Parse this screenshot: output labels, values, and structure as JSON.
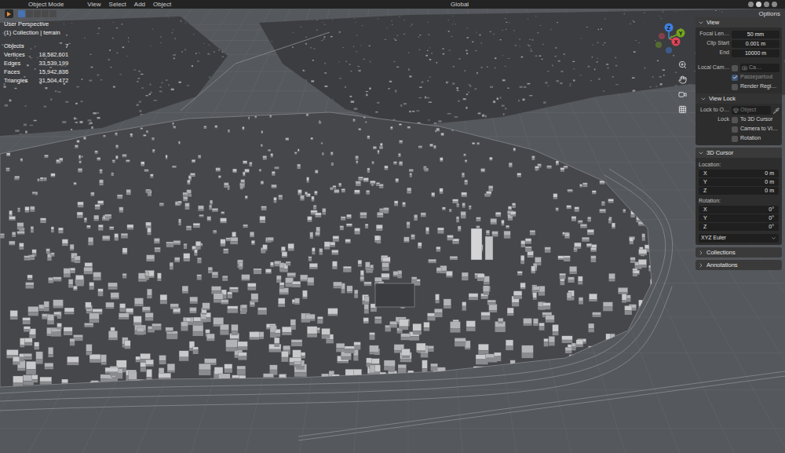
{
  "header": {
    "menus": [
      "Object Mode",
      "View",
      "Select",
      "Add",
      "Object"
    ],
    "orientation": "Global",
    "options": "Options",
    "select_modes": [
      {
        "selected": true
      },
      {
        "selected": false
      },
      {
        "selected": false
      },
      {
        "selected": false
      },
      {
        "selected": false
      }
    ]
  },
  "overlay": {
    "view": "User Perspective",
    "collection": "(1) Collection | terrain",
    "stats": [
      {
        "label": "Objects",
        "value": "7"
      },
      {
        "label": "Vertices",
        "value": "18,582,601"
      },
      {
        "label": "Edges",
        "value": "33,539,199"
      },
      {
        "label": "Faces",
        "value": "15,942,836"
      },
      {
        "label": "Triangles",
        "value": "31,504,472"
      }
    ]
  },
  "gizmo": {
    "axes": [
      {
        "label": "X",
        "color": "#e0455a"
      },
      {
        "label": "Y",
        "color": "#74a51f"
      },
      {
        "label": "Z",
        "color": "#3d80e0"
      }
    ]
  },
  "sidebar": {
    "view": {
      "title": "View",
      "expanded": true,
      "fields": [
        {
          "label": "Focal Len…",
          "value": "50 mm"
        },
        {
          "label": "Clip Start",
          "value": "0.001 m"
        },
        {
          "label": "End",
          "value": "10000 m"
        }
      ],
      "local_camera": {
        "label": "Local Cam…",
        "value": "Ca…",
        "checked": false
      },
      "checks": [
        {
          "label": "Passepartout",
          "checked": true,
          "disabled": true
        },
        {
          "label": "Render Regi…",
          "checked": false,
          "disabled": false
        }
      ]
    },
    "view_lock": {
      "title": "View Lock",
      "expanded": true,
      "lock_to_object": {
        "label": "Lock to O…",
        "placeholder": "Object"
      },
      "lock_label": "Lock",
      "checks": [
        {
          "label": "To 3D Cursor",
          "checked": false
        },
        {
          "label": "Camera to Vi…",
          "checked": false
        },
        {
          "label": "Rotation",
          "checked": false
        }
      ]
    },
    "cursor": {
      "title": "3D Cursor",
      "expanded": true,
      "location": {
        "label": "Location:",
        "fields": [
          {
            "axis": "X",
            "value": "0 m"
          },
          {
            "axis": "Y",
            "value": "0 m"
          },
          {
            "axis": "Z",
            "value": "0 m"
          }
        ]
      },
      "rotation": {
        "label": "Rotation:",
        "fields": [
          {
            "axis": "X",
            "value": "0°"
          },
          {
            "axis": "Y",
            "value": "0°"
          },
          {
            "axis": "Z",
            "value": "0°"
          }
        ]
      },
      "mode": "XYZ Euler"
    },
    "collapsed": [
      {
        "title": "Collections",
        "expanded": false
      },
      {
        "title": "Annotations",
        "expanded": false
      }
    ]
  }
}
